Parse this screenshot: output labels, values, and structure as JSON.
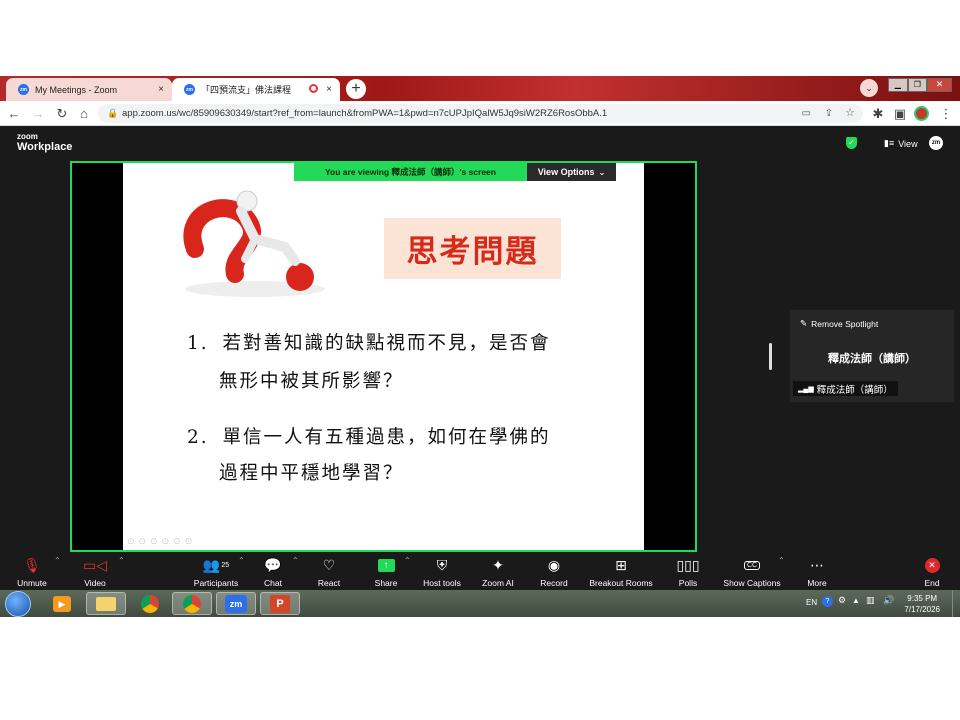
{
  "browser": {
    "tabs": [
      {
        "label": "My Meetings - Zoom",
        "favicon": "zm",
        "active": false
      },
      {
        "label": "「四預流支」佛法課程",
        "favicon": "zm",
        "active": true
      }
    ],
    "new_tab_symbol": "+",
    "close_symbol": "×",
    "url": "app.zoom.us/wc/85909630349/start?ref_from=launch&fromPWA=1&pwd=n7cUPJpIQalW5Jq9siW2RZ6RosObbA.1"
  },
  "zoom_header": {
    "logo_top": "zoom",
    "logo_bottom": "Workplace",
    "view_label": "View",
    "account_badge": "zm"
  },
  "share": {
    "viewing_text": "You are viewing  釋成法師（講師）'s screen",
    "view_options_label": "View Options"
  },
  "slide": {
    "title": "思考問題",
    "questions": [
      {
        "number": "1.",
        "line1": "若對善知識的缺點視而不見，是否會",
        "line2": "無形中被其所影響？"
      },
      {
        "number": "2.",
        "line1": "單信一人有五種過患，如何在學佛的",
        "line2": "過程中平穩地學習？"
      }
    ]
  },
  "side_panel": {
    "remove_spotlight_label": "Remove Spotlight",
    "participant_name": "釋成法師（講師）",
    "participant_label": "釋成法師（講師）"
  },
  "toolbar": {
    "unmute": "Unmute",
    "video": "Video",
    "participants": "Participants",
    "participants_count": "25",
    "chat": "Chat",
    "react": "React",
    "share": "Share",
    "host_tools": "Host tools",
    "zoom_ai": "Zoom AI",
    "record": "Record",
    "breakout_rooms": "Breakout Rooms",
    "polls": "Polls",
    "show_captions": "Show Captions",
    "more": "More",
    "end": "End"
  },
  "taskbar": {
    "language": "EN",
    "time": "9:35 PM",
    "date": "7/17/2026",
    "zoom_app_label": "zm",
    "ppt_label": "P"
  },
  "colors": {
    "share_border": "#23d959",
    "slide_title": "#d62a1b",
    "slide_title_bg": "#fbe4d6",
    "tab_strip": "#a01818",
    "end_red": "#e02828"
  }
}
